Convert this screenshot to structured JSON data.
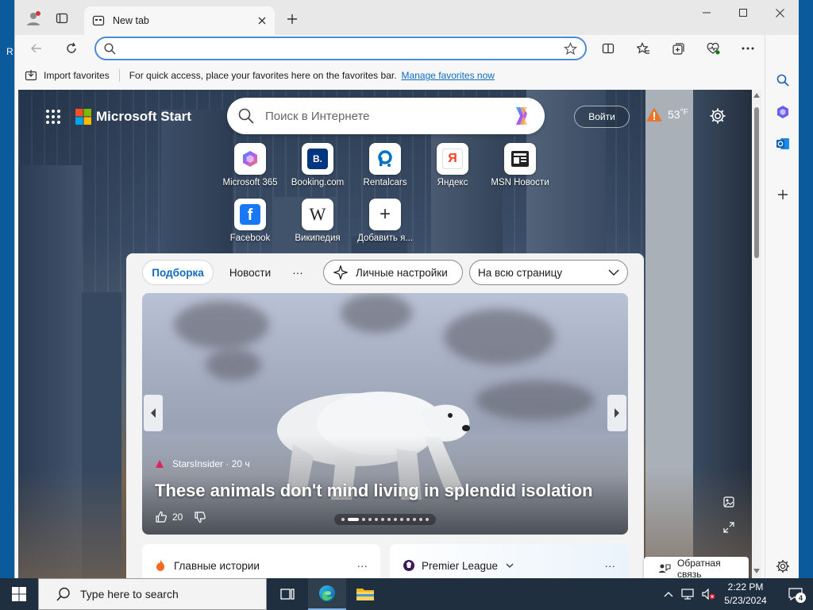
{
  "browser": {
    "tab_title": "New tab",
    "address_value": "",
    "favorites_bar": {
      "import_label": "Import favorites",
      "hint": "For quick access, place your favorites here on the favorites bar.",
      "manage_link": "Manage favorites now"
    }
  },
  "newtab": {
    "brand": "Microsoft Start",
    "search_placeholder": "Поиск в Интернете",
    "login_label": "Войти",
    "weather_temp": "53",
    "weather_unit": "°F",
    "quick_links": [
      {
        "label": "Microsoft 365",
        "glyph": "",
        "icon": "microsoft-365-icon"
      },
      {
        "label": "Booking.com",
        "glyph": "B.",
        "icon": "booking-icon"
      },
      {
        "label": "Rentalcars",
        "glyph": "R",
        "icon": "rentalcars-icon"
      },
      {
        "label": "Яндекс",
        "glyph": "Я",
        "icon": "yandex-icon"
      },
      {
        "label": "MSN Новости",
        "glyph": "",
        "icon": "msn-news-icon"
      },
      {
        "label": "Facebook",
        "glyph": "f",
        "icon": "facebook-icon"
      },
      {
        "label": "Википедия",
        "glyph": "W",
        "icon": "wikipedia-icon"
      },
      {
        "label": "Добавить я...",
        "glyph": "+",
        "icon": "add-icon"
      }
    ],
    "feed_tabs": {
      "podborka": "Подборка",
      "novosti": "Новости",
      "more": "···",
      "personal": "Личные настройки",
      "layout": "На всю страницу"
    },
    "hero": {
      "source": "StarsInsider · 20 ч",
      "title": "These animals don't mind living in splendid isolation",
      "likes": "20",
      "slide_count": 13,
      "active_slide": 1
    },
    "cards": {
      "stories": "Главные истории",
      "league": "Premier League",
      "more": "···"
    },
    "feedback_label": "Обратная связь"
  },
  "taskbar": {
    "search_placeholder": "Type here to search",
    "time": "2:22 PM",
    "date": "5/23/2024",
    "notifications": "4"
  },
  "colors": {
    "accent": "#0f6cbd",
    "address_border": "#4a8ad6",
    "taskbar": "#1f2f3f"
  }
}
